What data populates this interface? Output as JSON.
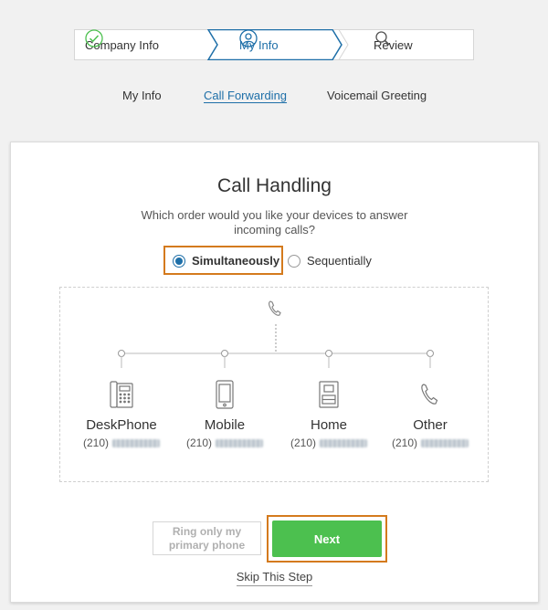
{
  "stepper": {
    "steps": [
      {
        "label": "Company Info",
        "icon": "check-circle-icon",
        "state": "done"
      },
      {
        "label": "My Info",
        "icon": "user-circle-icon",
        "state": "active"
      },
      {
        "label": "Review",
        "icon": "search-icon",
        "state": "pending"
      }
    ]
  },
  "subnav": {
    "items": [
      "My Info",
      "Call Forwarding",
      "Voicemail Greeting"
    ],
    "current": "Call Forwarding"
  },
  "card": {
    "title": "Call Handling",
    "question": "Which order would you like your devices to answer incoming calls?",
    "options": [
      {
        "label": "Simultaneously",
        "checked": true
      },
      {
        "label": "Sequentially",
        "checked": false
      }
    ],
    "devices": [
      {
        "name": "DeskPhone",
        "area_code": "(210)",
        "icon": "desk-phone-icon"
      },
      {
        "name": "Mobile",
        "area_code": "(210)",
        "icon": "mobile-phone-icon"
      },
      {
        "name": "Home",
        "area_code": "(210)",
        "icon": "home-phone-icon"
      },
      {
        "name": "Other",
        "area_code": "(210)",
        "icon": "phone-handset-icon"
      }
    ],
    "ring_primary_label": "Ring only my primary phone",
    "next_label": "Next",
    "skip_label": "Skip This Step"
  },
  "colors": {
    "accent": "#1e6fa8",
    "highlight": "#d47a1d",
    "next_button": "#4cc04f",
    "check": "#4cc04f"
  }
}
